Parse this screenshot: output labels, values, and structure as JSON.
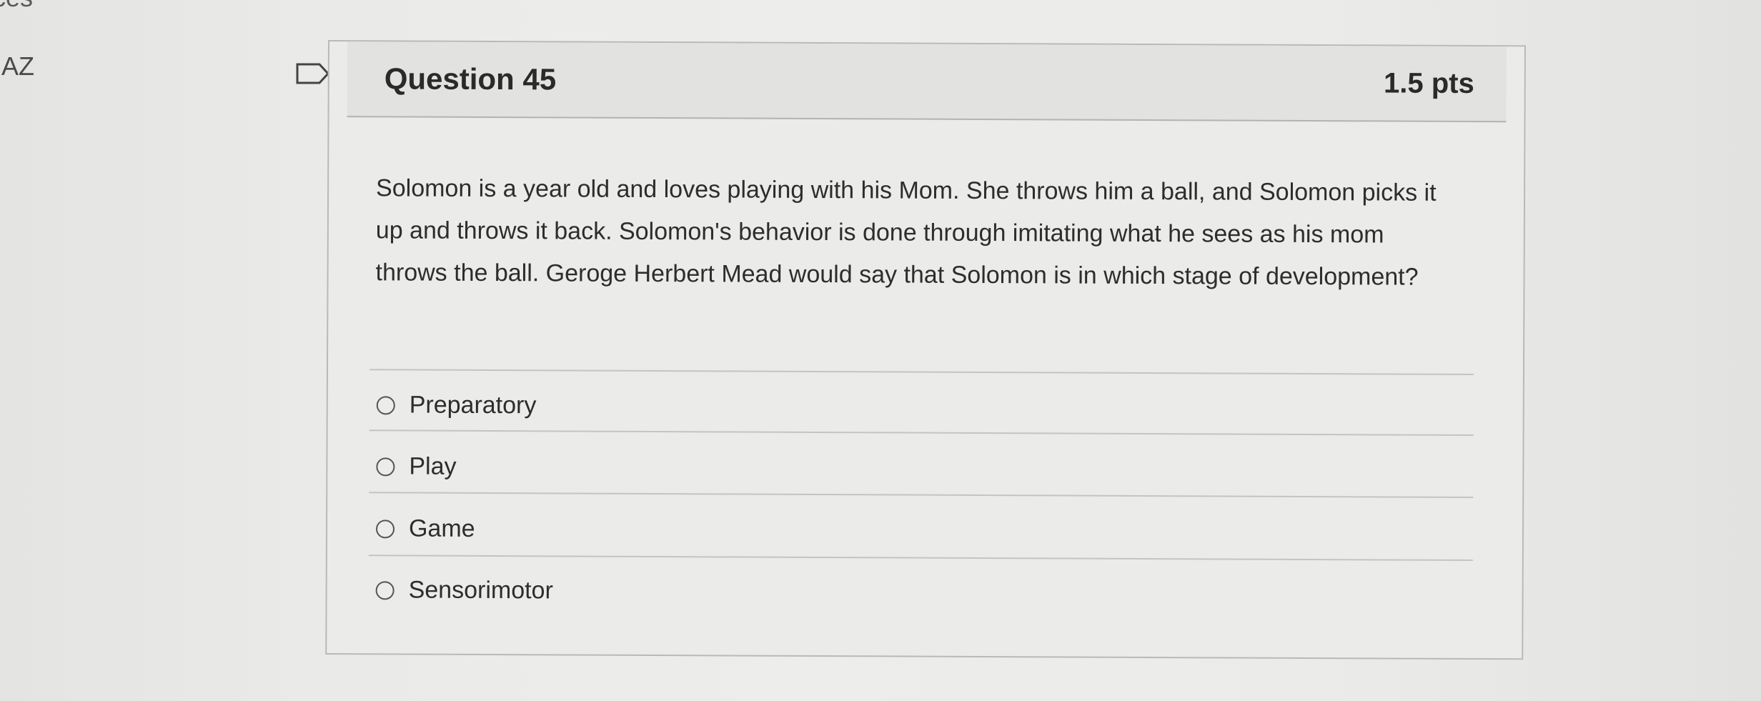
{
  "left_fragment_top": "ces",
  "left_fragment_az": "AZ",
  "question": {
    "title": "Question 45",
    "points": "1.5 pts",
    "text": "Solomon is a year old and loves playing with his Mom. She throws him a ball, and Solomon picks it up and throws it back.  Solomon's behavior is done through imitating what he sees as his mom throws the ball. Geroge Herbert Mead would say that Solomon is in which stage of development?",
    "answers": [
      {
        "label": "Preparatory"
      },
      {
        "label": "Play"
      },
      {
        "label": "Game"
      },
      {
        "label": "Sensorimotor"
      }
    ]
  },
  "colors": {
    "background": "#ebebe9",
    "header_bg": "#e2e2e0",
    "border": "#b9b9b7",
    "text": "#2d2d2d"
  }
}
